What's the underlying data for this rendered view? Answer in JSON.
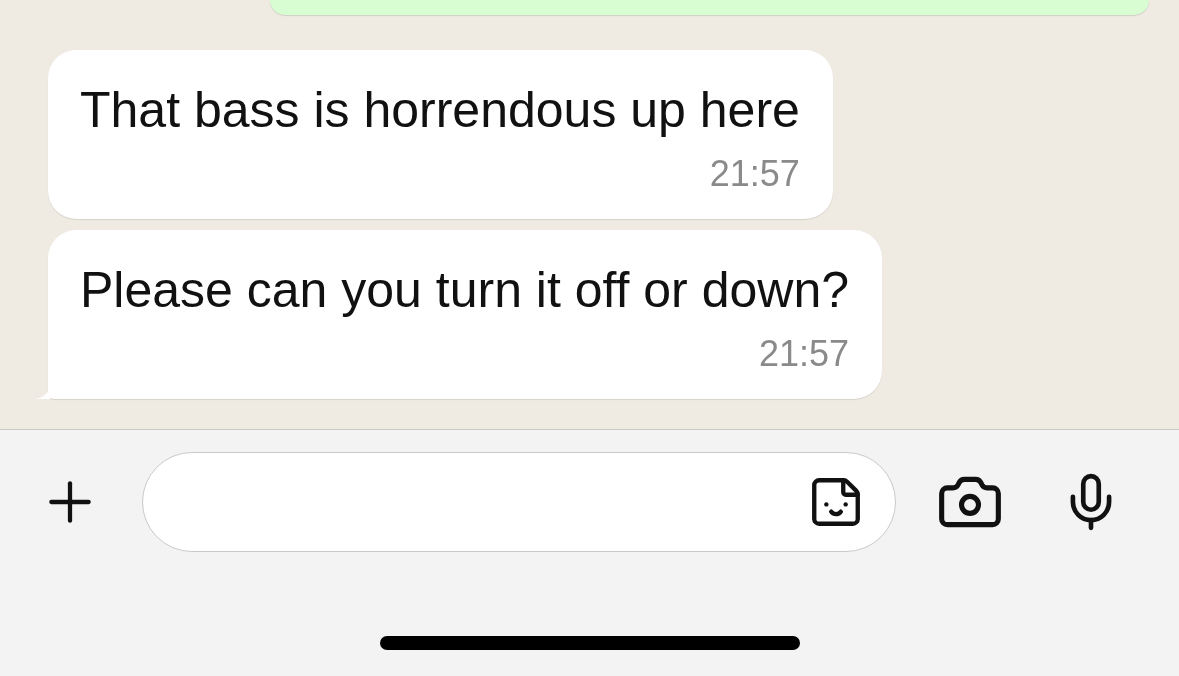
{
  "messages": [
    {
      "kind": "outgoing"
    },
    {
      "kind": "incoming",
      "text": "That bass is horrendous up here",
      "time": "21:57",
      "tail": false
    },
    {
      "kind": "incoming",
      "text": "Please can you turn it off or down?",
      "time": "21:57",
      "tail": true
    }
  ]
}
